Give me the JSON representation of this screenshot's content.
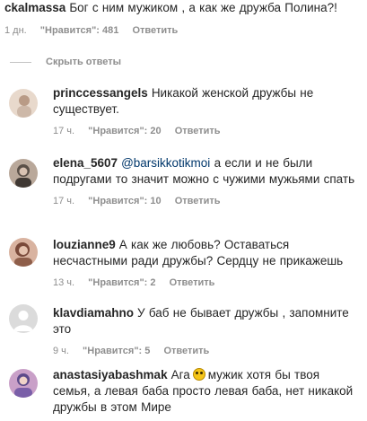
{
  "top_comment": {
    "username": "ckalmassa",
    "text": "Бог с ним мужиком , а как же дружба Полина?!",
    "time": "1 дн.",
    "likes": "\"Нравится\": 481",
    "reply_label": "Ответить"
  },
  "hide_replies_label": "Скрыть ответы",
  "replies": [
    {
      "username": "princcessangels",
      "text": "Никакой женской дружбы не существует.",
      "time": "17 ч.",
      "likes": "\"Нравится\": 20",
      "reply_label": "Ответить",
      "avatar_colors": [
        "#e8d9cc",
        "#b99b86"
      ]
    },
    {
      "username": "elena_5607",
      "mention": "@barsikkotikmoi",
      "text": "а если и не были подругами то значит можно с чужими мужьями спать",
      "time": "17 ч.",
      "likes": "\"Нравится\": 10",
      "reply_label": "Ответить",
      "avatar_colors": [
        "#5a5048",
        "#b9a89a"
      ]
    },
    {
      "username": "louzianne9",
      "text": "А как же любовь? Оставаться несчастными ради дружбы? Сердцу не прикажешь",
      "time": "13 ч.",
      "likes": "\"Нравится\": 2",
      "reply_label": "Ответить",
      "avatar_colors": [
        "#7a4a3a",
        "#d9b3a0"
      ]
    },
    {
      "username": "klavdiamahno",
      "text": "У баб не бывает дружбы , запомните это",
      "time": "9 ч.",
      "likes": "\"Нравится\": 5",
      "reply_label": "Ответить",
      "avatar_colors": [
        "#dbdbdb",
        "#ffffff"
      ]
    },
    {
      "username": "anastasiyabashmak",
      "text_before": "Ага",
      "emoji_icon": "grimacing-face-icon",
      "text_after": "мужик хотя бы твоя семья, а левая баба просто левая баба, нет никакой дружбы в этом Мире",
      "avatar_colors": [
        "#5b4a8a",
        "#c9a0c8"
      ]
    }
  ]
}
